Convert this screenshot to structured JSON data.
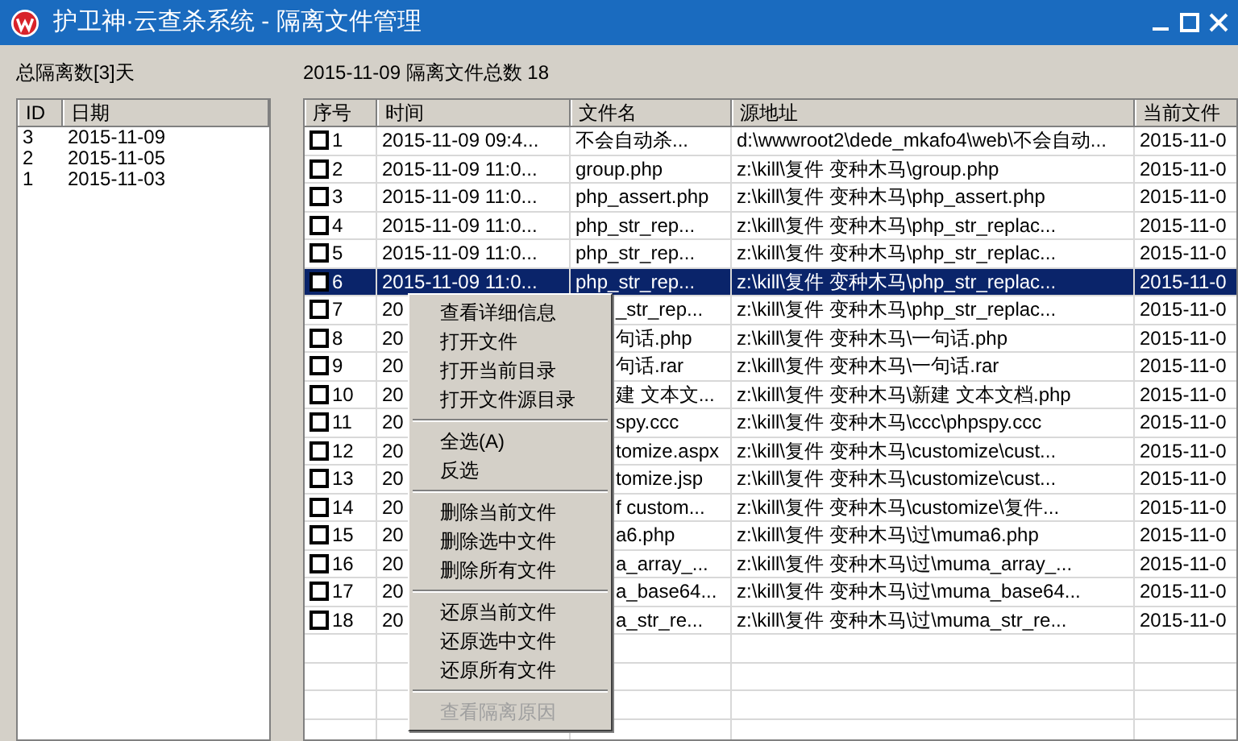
{
  "window": {
    "title": "护卫神·云查杀系统 - 隔离文件管理"
  },
  "left": {
    "summary": "总隔离数[3]天",
    "columns": [
      "ID",
      "日期"
    ],
    "rows": [
      [
        "3",
        "2015-11-09"
      ],
      [
        "2",
        "2015-11-05"
      ],
      [
        "1",
        "2015-11-03"
      ]
    ]
  },
  "right": {
    "summary": "2015-11-09 隔离文件总数 18",
    "columns": [
      "序号",
      "时间",
      "文件名",
      "源地址",
      "当前文件"
    ],
    "rows": [
      {
        "checked": false,
        "selected": false,
        "covered": false,
        "cells": [
          "1",
          "2015-11-09 09:4...",
          "不会自动杀...",
          "d:\\wwwroot2\\dede_mkafo4\\web\\不会自动...",
          "2015-11-0"
        ]
      },
      {
        "checked": false,
        "selected": false,
        "covered": false,
        "cells": [
          "2",
          "2015-11-09 11:0...",
          "group.php",
          "z:\\kill\\复件 变种木马\\group.php",
          "2015-11-0"
        ]
      },
      {
        "checked": false,
        "selected": false,
        "covered": false,
        "cells": [
          "3",
          "2015-11-09 11:0...",
          "php_assert.php",
          "z:\\kill\\复件 变种木马\\php_assert.php",
          "2015-11-0"
        ]
      },
      {
        "checked": false,
        "selected": false,
        "covered": false,
        "cells": [
          "4",
          "2015-11-09 11:0...",
          "php_str_rep...",
          "z:\\kill\\复件 变种木马\\php_str_replac...",
          "2015-11-0"
        ]
      },
      {
        "checked": false,
        "selected": false,
        "covered": false,
        "cells": [
          "5",
          "2015-11-09 11:0...",
          "php_str_rep...",
          "z:\\kill\\复件 变种木马\\php_str_replac...",
          "2015-11-0"
        ]
      },
      {
        "checked": false,
        "selected": true,
        "covered": false,
        "cells": [
          "6",
          "2015-11-09 11:0...",
          "php_str_rep...",
          "z:\\kill\\复件 变种木马\\php_str_replac...",
          "2015-11-0"
        ]
      },
      {
        "checked": false,
        "selected": false,
        "covered": true,
        "cells": [
          "7",
          "20",
          "_str_rep...",
          "z:\\kill\\复件 变种木马\\php_str_replac...",
          "2015-11-0"
        ]
      },
      {
        "checked": false,
        "selected": false,
        "covered": true,
        "cells": [
          "8",
          "20",
          "句话.php",
          "z:\\kill\\复件 变种木马\\一句话.php",
          "2015-11-0"
        ]
      },
      {
        "checked": false,
        "selected": false,
        "covered": true,
        "cells": [
          "9",
          "20",
          "句话.rar",
          "z:\\kill\\复件 变种木马\\一句话.rar",
          "2015-11-0"
        ]
      },
      {
        "checked": false,
        "selected": false,
        "covered": true,
        "cells": [
          "10",
          "20",
          "建 文本文...",
          "z:\\kill\\复件 变种木马\\新建 文本文档.php",
          "2015-11-0"
        ]
      },
      {
        "checked": false,
        "selected": false,
        "covered": true,
        "cells": [
          "11",
          "20",
          "spy.ccc",
          "z:\\kill\\复件 变种木马\\ccc\\phpspy.ccc",
          "2015-11-0"
        ]
      },
      {
        "checked": false,
        "selected": false,
        "covered": true,
        "cells": [
          "12",
          "20",
          "tomize.aspx",
          "z:\\kill\\复件 变种木马\\customize\\cust...",
          "2015-11-0"
        ]
      },
      {
        "checked": false,
        "selected": false,
        "covered": true,
        "cells": [
          "13",
          "20",
          "tomize.jsp",
          "z:\\kill\\复件 变种木马\\customize\\cust...",
          "2015-11-0"
        ]
      },
      {
        "checked": false,
        "selected": false,
        "covered": true,
        "cells": [
          "14",
          "20",
          "f custom...",
          "z:\\kill\\复件 变种木马\\customize\\复件...",
          "2015-11-0"
        ]
      },
      {
        "checked": false,
        "selected": false,
        "covered": true,
        "cells": [
          "15",
          "20",
          "a6.php",
          "z:\\kill\\复件 变种木马\\过\\muma6.php",
          "2015-11-0"
        ]
      },
      {
        "checked": false,
        "selected": false,
        "covered": true,
        "cells": [
          "16",
          "20",
          "a_array_...",
          "z:\\kill\\复件 变种木马\\过\\muma_array_...",
          "2015-11-0"
        ]
      },
      {
        "checked": false,
        "selected": false,
        "covered": true,
        "cells": [
          "17",
          "20",
          "a_base64...",
          "z:\\kill\\复件 变种木马\\过\\muma_base64...",
          "2015-11-0"
        ]
      },
      {
        "checked": false,
        "selected": false,
        "covered": true,
        "cells": [
          "18",
          "20",
          "a_str_re...",
          "z:\\kill\\复件 变种木马\\过\\muma_str_re...",
          "2015-11-0"
        ]
      }
    ]
  },
  "context_menu": [
    {
      "kind": "item",
      "label": "查看详细信息",
      "disabled": false
    },
    {
      "kind": "item",
      "label": "打开文件",
      "disabled": false
    },
    {
      "kind": "item",
      "label": "打开当前目录",
      "disabled": false
    },
    {
      "kind": "item",
      "label": "打开文件源目录",
      "disabled": false
    },
    {
      "kind": "separator"
    },
    {
      "kind": "item",
      "label": "全选(A)",
      "disabled": false
    },
    {
      "kind": "item",
      "label": "反选",
      "disabled": false
    },
    {
      "kind": "separator"
    },
    {
      "kind": "item",
      "label": "删除当前文件",
      "disabled": false
    },
    {
      "kind": "item",
      "label": "删除选中文件",
      "disabled": false
    },
    {
      "kind": "item",
      "label": "删除所有文件",
      "disabled": false
    },
    {
      "kind": "separator"
    },
    {
      "kind": "item",
      "label": "还原当前文件",
      "disabled": false
    },
    {
      "kind": "item",
      "label": "还原选中文件",
      "disabled": false
    },
    {
      "kind": "item",
      "label": "还原所有文件",
      "disabled": false
    },
    {
      "kind": "separator"
    },
    {
      "kind": "item",
      "label": "查看隔离原因",
      "disabled": true
    }
  ]
}
